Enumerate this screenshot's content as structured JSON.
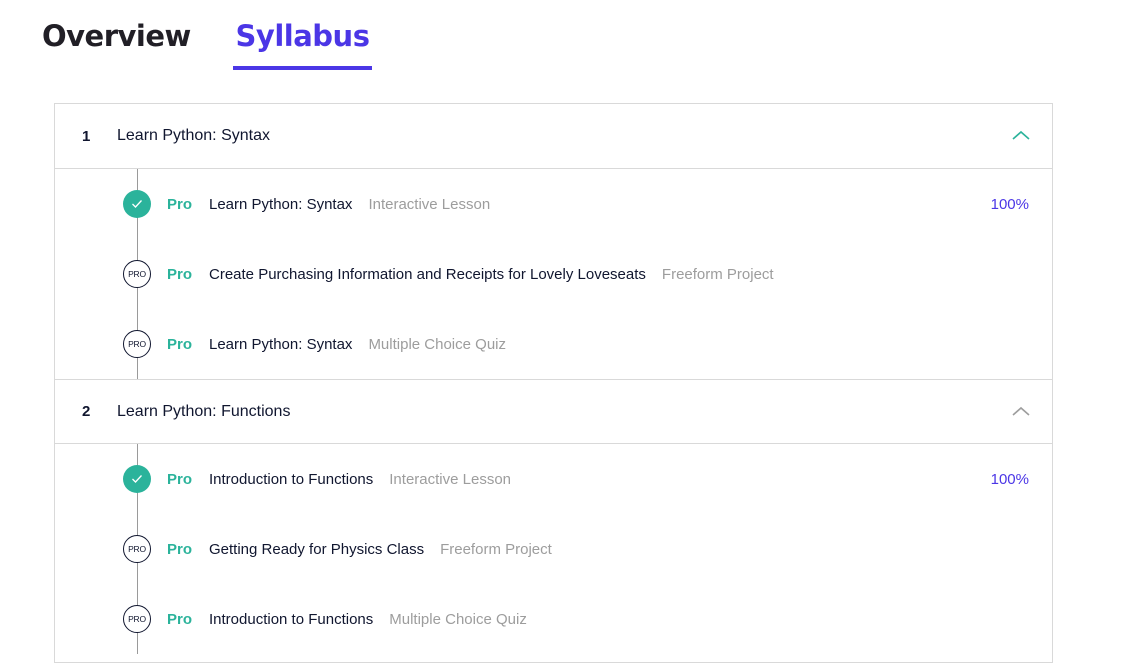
{
  "tabs": {
    "overview": "Overview",
    "syllabus": "Syllabus",
    "active": "Syllabus"
  },
  "colors": {
    "accent": "#4b36e6",
    "pro": "#2bb39b",
    "text": "#10162f",
    "muted": "#9d9d9d",
    "border": "#d9d9d9"
  },
  "modules": [
    {
      "number": "1",
      "title": "Learn Python: Syntax",
      "chevron_icon": "chevron-up-icon",
      "expanded": true,
      "items": [
        {
          "status": "completed",
          "status_icon": "check-icon",
          "badge": "Pro",
          "title": "Learn Python: Syntax",
          "type": "Interactive Lesson",
          "progress": "100%"
        },
        {
          "status": "locked",
          "status_icon": "pro-icon",
          "status_text": "PRO",
          "badge": "Pro",
          "title": "Create Purchasing Information and Receipts for Lovely Loveseats",
          "type": "Freeform Project"
        },
        {
          "status": "locked",
          "status_icon": "pro-icon",
          "status_text": "PRO",
          "badge": "Pro",
          "title": "Learn Python: Syntax",
          "type": "Multiple Choice Quiz"
        }
      ]
    },
    {
      "number": "2",
      "title": "Learn Python: Functions",
      "chevron_icon": "chevron-up-icon",
      "expanded": true,
      "items": [
        {
          "status": "completed",
          "status_icon": "check-icon",
          "badge": "Pro",
          "title": "Introduction to Functions",
          "type": "Interactive Lesson",
          "progress": "100%"
        },
        {
          "status": "locked",
          "status_icon": "pro-icon",
          "status_text": "PRO",
          "badge": "Pro",
          "title": "Getting Ready for Physics Class",
          "type": "Freeform Project"
        },
        {
          "status": "locked",
          "status_icon": "pro-icon",
          "status_text": "PRO",
          "badge": "Pro",
          "title": "Introduction to Functions",
          "type": "Multiple Choice Quiz"
        }
      ]
    }
  ]
}
